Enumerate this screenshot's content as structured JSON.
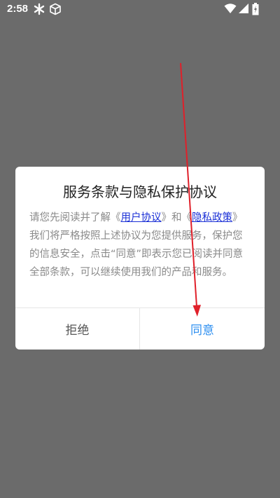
{
  "status_bar": {
    "time": "2:58",
    "left_icons": [
      "asterisk-icon",
      "cube-icon"
    ],
    "right_icons": [
      "wifi-icon",
      "signal-icon",
      "battery-icon"
    ]
  },
  "dialog": {
    "title": "服务条款与隐私保护协议",
    "body": {
      "prefix": "请您先阅读并了解《",
      "link_user_agreement": "用户协议",
      "middle": "》和《",
      "link_privacy_policy": "隐私政策",
      "suffix": "》我们将严格按照上述协议为您提供服务，保护您的信息安全，点击“同意”即表示您已阅读并同意全部条款，可以继续使用我们的产品和服务。"
    },
    "buttons": {
      "reject": "拒绝",
      "agree": "同意"
    }
  },
  "colors": {
    "overlay": "#6b6b6b",
    "agree": "#2e8ff0",
    "link": "#1a2fd6",
    "annotation_arrow": "#e0202a"
  }
}
